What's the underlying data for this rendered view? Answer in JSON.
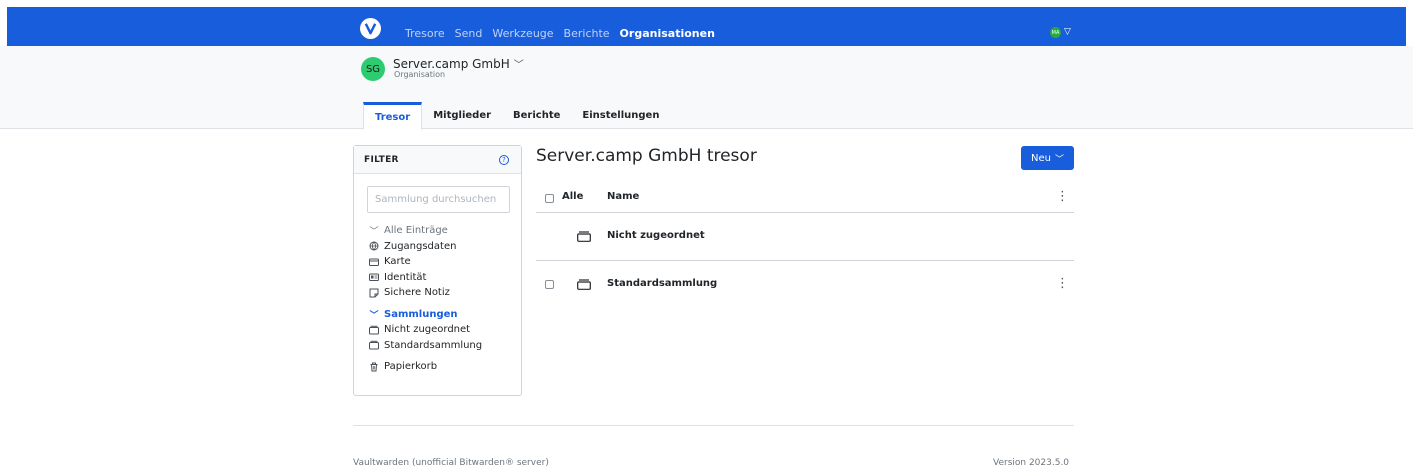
{
  "topnav": {
    "items": [
      "Tresore",
      "Send",
      "Werkzeuge",
      "Berichte",
      "Organisationen"
    ],
    "active_index": 4,
    "user_initials": "MA"
  },
  "org": {
    "initials": "SG",
    "name": "Server.camp GmbH",
    "subtitle": "Organisation"
  },
  "tabs": [
    "Tresor",
    "Mitglieder",
    "Berichte",
    "Einstellungen"
  ],
  "filter": {
    "title": "FILTER",
    "search_placeholder": "Sammlung durchsuchen",
    "all_items": "Alle Einträge",
    "types": [
      {
        "label": "Zugangsdaten",
        "icon": "globe-icon"
      },
      {
        "label": "Karte",
        "icon": "credit-card-icon"
      },
      {
        "label": "Identität",
        "icon": "id-card-icon"
      },
      {
        "label": "Sichere Notiz",
        "icon": "sticky-note-icon"
      }
    ],
    "collections_label": "Sammlungen",
    "collections": [
      "Nicht zugeordnet",
      "Standardsammlung"
    ],
    "trash": "Papierkorb"
  },
  "main": {
    "title": "Server.camp GmbH tresor",
    "new_button": "Neu",
    "header_all": "Alle",
    "header_name": "Name",
    "rows": [
      "Nicht zugeordnet",
      "Standardsammlung"
    ]
  },
  "footer": {
    "left": "Vaultwarden (unofficial Bitwarden® server)",
    "right": "Version 2023.5.0"
  },
  "colors": {
    "brand": "#175ddc",
    "org_avatar": "#2ecc71",
    "user_avatar": "#28a745"
  }
}
